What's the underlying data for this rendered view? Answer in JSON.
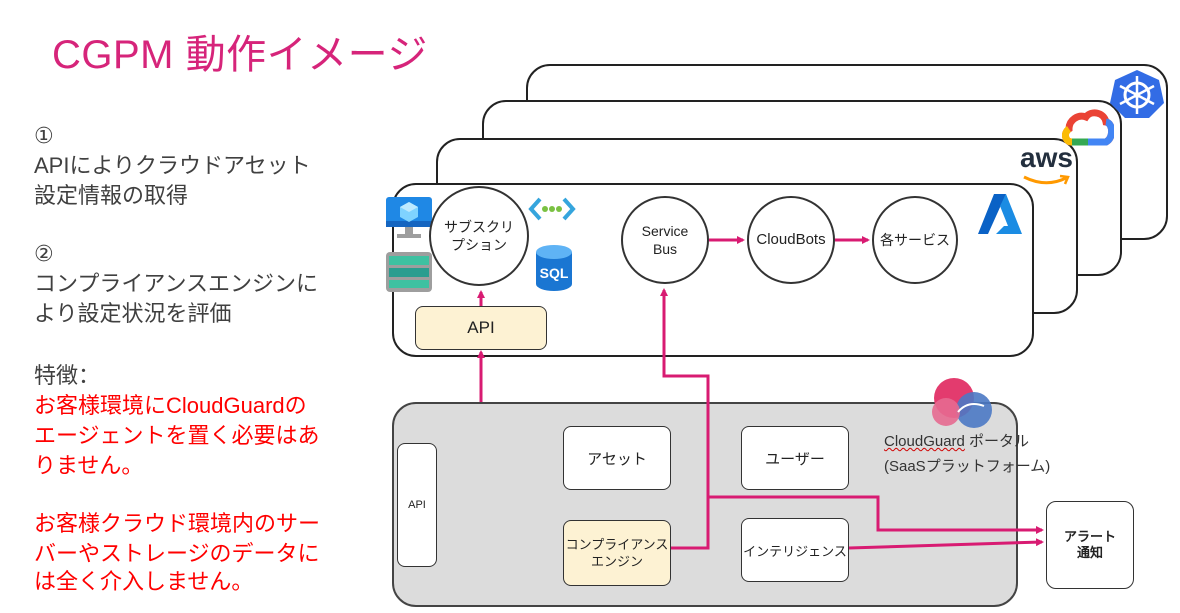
{
  "title": "CGPM 動作イメージ",
  "steps": [
    {
      "num": "①",
      "lines": [
        "APIによりクラウドアセット",
        "設定情報の取得"
      ]
    },
    {
      "num": "②",
      "lines": [
        "コンプライアンスエンジンに",
        "より設定状況を評価"
      ]
    }
  ],
  "features": {
    "label": "特徴：",
    "point1": [
      "お客様環境にCloudGuardの",
      "エージェントを置く必要はあ",
      "りません。"
    ],
    "point2": [
      "お客様クラウド環境内のサー",
      "バーやストレージのデータに",
      "は全く介入しません。"
    ]
  },
  "cloud": {
    "aws_text": "aws",
    "subscription": [
      "サブスクリ",
      "プション"
    ],
    "service_bus": [
      "Service",
      "Bus"
    ],
    "cloudbots": "CloudBots",
    "services": "各サービス",
    "api": "API",
    "sql_text": "SQL"
  },
  "portal": {
    "api": "API",
    "asset": "アセット",
    "user": "ユーザー",
    "compliance": [
      "コンプライアンス",
      "エンジン"
    ],
    "intelligence": "インテリジェンス",
    "label_brand": "CloudGuard",
    "label_rest": " ポータル",
    "label_line2": "(SaaSプラットフォーム)"
  },
  "alert": [
    "アラート",
    "通知"
  ],
  "colors": {
    "accent": "#d6247a",
    "arrow": "#d81b72",
    "red": "#ff0000"
  }
}
